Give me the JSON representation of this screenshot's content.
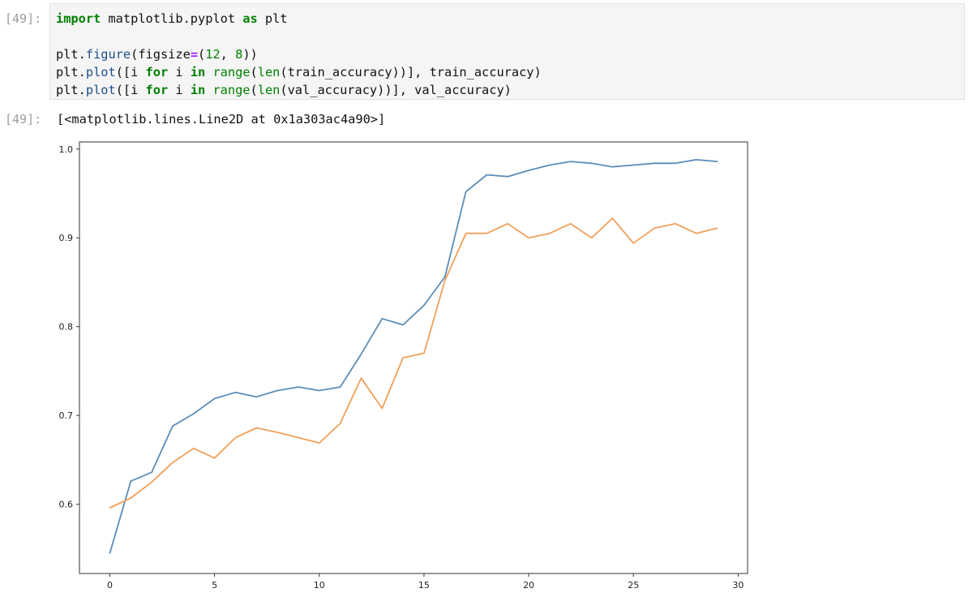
{
  "input_prompt": "[49]:",
  "output_prompt": "[49]:",
  "code_lines": [
    [
      {
        "t": "import",
        "c": "kw"
      },
      {
        "t": " matplotlib.pyplot ",
        "c": ""
      },
      {
        "t": "as",
        "c": "kw"
      },
      {
        "t": " plt",
        "c": ""
      }
    ],
    [],
    [
      {
        "t": "plt",
        "c": ""
      },
      {
        "t": ".",
        "c": ""
      },
      {
        "t": "figure",
        "c": "nm"
      },
      {
        "t": "(figsize",
        "c": ""
      },
      {
        "t": "=",
        "c": "op"
      },
      {
        "t": "(",
        "c": ""
      },
      {
        "t": "12",
        "c": "num"
      },
      {
        "t": ", ",
        "c": ""
      },
      {
        "t": "8",
        "c": "num"
      },
      {
        "t": "))",
        "c": ""
      }
    ],
    [
      {
        "t": "plt",
        "c": ""
      },
      {
        "t": ".",
        "c": ""
      },
      {
        "t": "plot",
        "c": "nm"
      },
      {
        "t": "([i ",
        "c": ""
      },
      {
        "t": "for",
        "c": "kw"
      },
      {
        "t": " i ",
        "c": ""
      },
      {
        "t": "in",
        "c": "kw"
      },
      {
        "t": " ",
        "c": ""
      },
      {
        "t": "range",
        "c": "num"
      },
      {
        "t": "(",
        "c": ""
      },
      {
        "t": "len",
        "c": "num"
      },
      {
        "t": "(train_accuracy))], train_accuracy)",
        "c": ""
      }
    ],
    [
      {
        "t": "plt",
        "c": ""
      },
      {
        "t": ".",
        "c": ""
      },
      {
        "t": "plot",
        "c": "nm"
      },
      {
        "t": "([i ",
        "c": ""
      },
      {
        "t": "for",
        "c": "kw"
      },
      {
        "t": " i ",
        "c": ""
      },
      {
        "t": "in",
        "c": "kw"
      },
      {
        "t": " ",
        "c": ""
      },
      {
        "t": "range",
        "c": "num"
      },
      {
        "t": "(",
        "c": ""
      },
      {
        "t": "len",
        "c": "num"
      },
      {
        "t": "(val_accuracy))], val_accuracy)",
        "c": ""
      }
    ]
  ],
  "output_text": "[<matplotlib.lines.Line2D at 0x1a303ac4a90>]",
  "chart_data": {
    "type": "line",
    "xlim": [
      -1.45,
      30.45
    ],
    "ylim": [
      0.522,
      1.008
    ],
    "xticks": [
      0,
      5,
      10,
      15,
      20,
      25,
      30
    ],
    "yticks": [
      0.6,
      0.7,
      0.8,
      0.9,
      1.0
    ],
    "ytick_labels": [
      "0.6",
      "0.7",
      "0.8",
      "0.9",
      "1.0"
    ],
    "grid": false,
    "series": [
      {
        "color": "#5b8db8",
        "x": [
          0,
          1,
          2,
          3,
          4,
          5,
          6,
          7,
          8,
          9,
          10,
          11,
          12,
          13,
          14,
          15,
          16,
          17,
          18,
          19,
          20,
          21,
          22,
          23,
          24,
          25,
          26,
          27,
          28,
          29
        ],
        "values": [
          0.545,
          0.626,
          0.636,
          0.688,
          0.702,
          0.719,
          0.726,
          0.721,
          0.728,
          0.732,
          0.728,
          0.732,
          0.769,
          0.809,
          0.802,
          0.824,
          0.856,
          0.952,
          0.971,
          0.969,
          0.976,
          0.982,
          0.986,
          0.984,
          0.98,
          0.982,
          0.984,
          0.984,
          0.988,
          0.986
        ]
      },
      {
        "color": "#f0a05a",
        "x": [
          0,
          1,
          2,
          3,
          4,
          5,
          6,
          7,
          8,
          9,
          10,
          11,
          12,
          13,
          14,
          15,
          16,
          17,
          18,
          19,
          20,
          21,
          22,
          23,
          24,
          25,
          26,
          27,
          28,
          29
        ],
        "values": [
          0.596,
          0.607,
          0.625,
          0.647,
          0.663,
          0.652,
          0.675,
          0.686,
          0.681,
          0.675,
          0.669,
          0.691,
          0.742,
          0.708,
          0.765,
          0.77,
          0.852,
          0.905,
          0.905,
          0.916,
          0.9,
          0.905,
          0.916,
          0.9,
          0.922,
          0.894,
          0.911,
          0.916,
          0.905,
          0.911
        ]
      }
    ]
  }
}
